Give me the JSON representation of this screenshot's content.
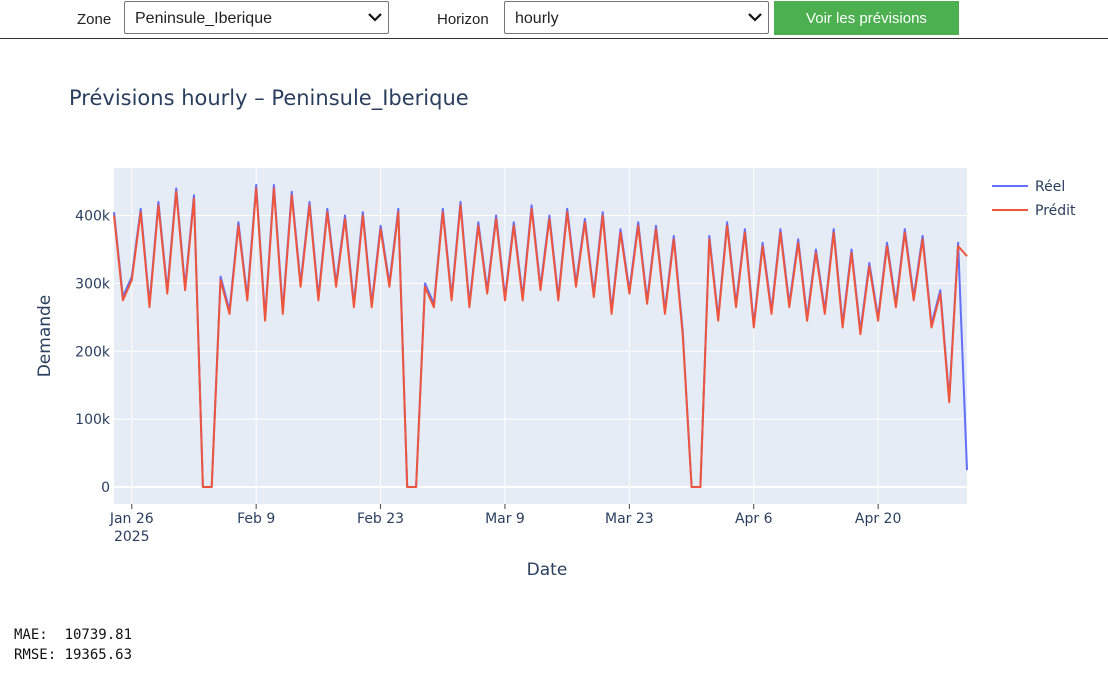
{
  "controls": {
    "zone_label": "Zone",
    "zone_value": "Peninsule_Iberique",
    "horizon_label": "Horizon",
    "horizon_value": "hourly",
    "submit_label": "Voir les prévisions"
  },
  "chart_data": {
    "type": "line",
    "title": "Prévisions hourly – Peninsule_Iberique",
    "xlabel": "Date",
    "ylabel": "Demande",
    "x_range": [
      "2025-01-24",
      "2025-04-30"
    ],
    "ylim": [
      -25000,
      470000
    ],
    "x_ticks": [
      {
        "date": "2025-01-26",
        "label": "Jan 26",
        "sublabel": "2025"
      },
      {
        "date": "2025-02-09",
        "label": "Feb 9"
      },
      {
        "date": "2025-02-23",
        "label": "Feb 23"
      },
      {
        "date": "2025-03-09",
        "label": "Mar 9"
      },
      {
        "date": "2025-03-23",
        "label": "Mar 23"
      },
      {
        "date": "2025-04-06",
        "label": "Apr 6"
      },
      {
        "date": "2025-04-20",
        "label": "Apr 20"
      }
    ],
    "y_ticks": [
      {
        "value": 0,
        "label": "0"
      },
      {
        "value": 100000,
        "label": "100k"
      },
      {
        "value": 200000,
        "label": "200k"
      },
      {
        "value": 300000,
        "label": "300k"
      },
      {
        "value": 400000,
        "label": "400k"
      }
    ],
    "grid": true,
    "legend_position": "top-right",
    "plot_bgcolor": "#e5ecf6",
    "series": [
      {
        "name": "Réel",
        "color": "#636efa",
        "points": [
          [
            "2025-01-24",
            405000
          ],
          [
            "2025-01-25",
            280000
          ],
          [
            "2025-01-26",
            310000
          ],
          [
            "2025-01-27",
            410000
          ],
          [
            "2025-01-28",
            270000
          ],
          [
            "2025-01-29",
            420000
          ],
          [
            "2025-01-30",
            290000
          ],
          [
            "2025-01-31",
            440000
          ],
          [
            "2025-02-01",
            295000
          ],
          [
            "2025-02-02",
            430000
          ],
          [
            "2025-02-03",
            0
          ],
          [
            "2025-02-04",
            0
          ],
          [
            "2025-02-05",
            310000
          ],
          [
            "2025-02-06",
            260000
          ],
          [
            "2025-02-07",
            390000
          ],
          [
            "2025-02-08",
            280000
          ],
          [
            "2025-02-09",
            445000
          ],
          [
            "2025-02-10",
            250000
          ],
          [
            "2025-02-11",
            445000
          ],
          [
            "2025-02-12",
            260000
          ],
          [
            "2025-02-13",
            435000
          ],
          [
            "2025-02-14",
            300000
          ],
          [
            "2025-02-15",
            420000
          ],
          [
            "2025-02-16",
            280000
          ],
          [
            "2025-02-17",
            410000
          ],
          [
            "2025-02-18",
            300000
          ],
          [
            "2025-02-19",
            400000
          ],
          [
            "2025-02-20",
            270000
          ],
          [
            "2025-02-21",
            405000
          ],
          [
            "2025-02-22",
            270000
          ],
          [
            "2025-02-23",
            385000
          ],
          [
            "2025-02-24",
            300000
          ],
          [
            "2025-02-25",
            410000
          ],
          [
            "2025-02-26",
            0
          ],
          [
            "2025-02-27",
            0
          ],
          [
            "2025-02-28",
            300000
          ],
          [
            "2025-03-01",
            270000
          ],
          [
            "2025-03-02",
            410000
          ],
          [
            "2025-03-03",
            280000
          ],
          [
            "2025-03-04",
            420000
          ],
          [
            "2025-03-05",
            270000
          ],
          [
            "2025-03-06",
            390000
          ],
          [
            "2025-03-07",
            290000
          ],
          [
            "2025-03-08",
            400000
          ],
          [
            "2025-03-09",
            280000
          ],
          [
            "2025-03-10",
            390000
          ],
          [
            "2025-03-11",
            280000
          ],
          [
            "2025-03-12",
            415000
          ],
          [
            "2025-03-13",
            295000
          ],
          [
            "2025-03-14",
            400000
          ],
          [
            "2025-03-15",
            280000
          ],
          [
            "2025-03-16",
            410000
          ],
          [
            "2025-03-17",
            300000
          ],
          [
            "2025-03-18",
            395000
          ],
          [
            "2025-03-19",
            285000
          ],
          [
            "2025-03-20",
            405000
          ],
          [
            "2025-03-21",
            260000
          ],
          [
            "2025-03-22",
            380000
          ],
          [
            "2025-03-23",
            290000
          ],
          [
            "2025-03-24",
            390000
          ],
          [
            "2025-03-25",
            275000
          ],
          [
            "2025-03-26",
            385000
          ],
          [
            "2025-03-27",
            260000
          ],
          [
            "2025-03-28",
            370000
          ],
          [
            "2025-03-29",
            230000
          ],
          [
            "2025-03-30",
            0
          ],
          [
            "2025-03-31",
            0
          ],
          [
            "2025-04-01",
            370000
          ],
          [
            "2025-04-02",
            250000
          ],
          [
            "2025-04-03",
            390000
          ],
          [
            "2025-04-04",
            270000
          ],
          [
            "2025-04-05",
            380000
          ],
          [
            "2025-04-06",
            240000
          ],
          [
            "2025-04-07",
            360000
          ],
          [
            "2025-04-08",
            260000
          ],
          [
            "2025-04-09",
            380000
          ],
          [
            "2025-04-10",
            270000
          ],
          [
            "2025-04-11",
            365000
          ],
          [
            "2025-04-12",
            250000
          ],
          [
            "2025-04-13",
            350000
          ],
          [
            "2025-04-14",
            260000
          ],
          [
            "2025-04-15",
            380000
          ],
          [
            "2025-04-16",
            240000
          ],
          [
            "2025-04-17",
            350000
          ],
          [
            "2025-04-18",
            230000
          ],
          [
            "2025-04-19",
            330000
          ],
          [
            "2025-04-20",
            250000
          ],
          [
            "2025-04-21",
            360000
          ],
          [
            "2025-04-22",
            270000
          ],
          [
            "2025-04-23",
            380000
          ],
          [
            "2025-04-24",
            280000
          ],
          [
            "2025-04-25",
            370000
          ],
          [
            "2025-04-26",
            240000
          ],
          [
            "2025-04-27",
            290000
          ],
          [
            "2025-04-28",
            130000
          ],
          [
            "2025-04-29",
            360000
          ],
          [
            "2025-04-30",
            25000
          ]
        ]
      },
      {
        "name": "Prédit",
        "color": "#ef553b",
        "points": [
          [
            "2025-01-24",
            400000
          ],
          [
            "2025-01-25",
            275000
          ],
          [
            "2025-01-26",
            305000
          ],
          [
            "2025-01-27",
            405000
          ],
          [
            "2025-01-28",
            265000
          ],
          [
            "2025-01-29",
            415000
          ],
          [
            "2025-01-30",
            285000
          ],
          [
            "2025-01-31",
            435000
          ],
          [
            "2025-02-01",
            290000
          ],
          [
            "2025-02-02",
            425000
          ],
          [
            "2025-02-03",
            0
          ],
          [
            "2025-02-04",
            0
          ],
          [
            "2025-02-05",
            305000
          ],
          [
            "2025-02-06",
            255000
          ],
          [
            "2025-02-07",
            385000
          ],
          [
            "2025-02-08",
            275000
          ],
          [
            "2025-02-09",
            440000
          ],
          [
            "2025-02-10",
            245000
          ],
          [
            "2025-02-11",
            440000
          ],
          [
            "2025-02-12",
            255000
          ],
          [
            "2025-02-13",
            430000
          ],
          [
            "2025-02-14",
            295000
          ],
          [
            "2025-02-15",
            415000
          ],
          [
            "2025-02-16",
            275000
          ],
          [
            "2025-02-17",
            405000
          ],
          [
            "2025-02-18",
            295000
          ],
          [
            "2025-02-19",
            395000
          ],
          [
            "2025-02-20",
            265000
          ],
          [
            "2025-02-21",
            400000
          ],
          [
            "2025-02-22",
            265000
          ],
          [
            "2025-02-23",
            380000
          ],
          [
            "2025-02-24",
            295000
          ],
          [
            "2025-02-25",
            405000
          ],
          [
            "2025-02-26",
            0
          ],
          [
            "2025-02-27",
            0
          ],
          [
            "2025-02-28",
            295000
          ],
          [
            "2025-03-01",
            265000
          ],
          [
            "2025-03-02",
            405000
          ],
          [
            "2025-03-03",
            275000
          ],
          [
            "2025-03-04",
            415000
          ],
          [
            "2025-03-05",
            265000
          ],
          [
            "2025-03-06",
            385000
          ],
          [
            "2025-03-07",
            285000
          ],
          [
            "2025-03-08",
            395000
          ],
          [
            "2025-03-09",
            275000
          ],
          [
            "2025-03-10",
            385000
          ],
          [
            "2025-03-11",
            275000
          ],
          [
            "2025-03-12",
            410000
          ],
          [
            "2025-03-13",
            290000
          ],
          [
            "2025-03-14",
            395000
          ],
          [
            "2025-03-15",
            275000
          ],
          [
            "2025-03-16",
            405000
          ],
          [
            "2025-03-17",
            295000
          ],
          [
            "2025-03-18",
            390000
          ],
          [
            "2025-03-19",
            280000
          ],
          [
            "2025-03-20",
            400000
          ],
          [
            "2025-03-21",
            255000
          ],
          [
            "2025-03-22",
            375000
          ],
          [
            "2025-03-23",
            285000
          ],
          [
            "2025-03-24",
            385000
          ],
          [
            "2025-03-25",
            270000
          ],
          [
            "2025-03-26",
            380000
          ],
          [
            "2025-03-27",
            255000
          ],
          [
            "2025-03-28",
            365000
          ],
          [
            "2025-03-29",
            225000
          ],
          [
            "2025-03-30",
            0
          ],
          [
            "2025-03-31",
            0
          ],
          [
            "2025-04-01",
            365000
          ],
          [
            "2025-04-02",
            245000
          ],
          [
            "2025-04-03",
            385000
          ],
          [
            "2025-04-04",
            265000
          ],
          [
            "2025-04-05",
            375000
          ],
          [
            "2025-04-06",
            235000
          ],
          [
            "2025-04-07",
            355000
          ],
          [
            "2025-04-08",
            255000
          ],
          [
            "2025-04-09",
            375000
          ],
          [
            "2025-04-10",
            265000
          ],
          [
            "2025-04-11",
            360000
          ],
          [
            "2025-04-12",
            245000
          ],
          [
            "2025-04-13",
            345000
          ],
          [
            "2025-04-14",
            255000
          ],
          [
            "2025-04-15",
            375000
          ],
          [
            "2025-04-16",
            235000
          ],
          [
            "2025-04-17",
            345000
          ],
          [
            "2025-04-18",
            225000
          ],
          [
            "2025-04-19",
            325000
          ],
          [
            "2025-04-20",
            245000
          ],
          [
            "2025-04-21",
            355000
          ],
          [
            "2025-04-22",
            265000
          ],
          [
            "2025-04-23",
            375000
          ],
          [
            "2025-04-24",
            275000
          ],
          [
            "2025-04-25",
            365000
          ],
          [
            "2025-04-26",
            235000
          ],
          [
            "2025-04-27",
            285000
          ],
          [
            "2025-04-28",
            125000
          ],
          [
            "2025-04-29",
            355000
          ],
          [
            "2025-04-30",
            340000
          ]
        ]
      }
    ]
  },
  "metrics": {
    "mae_label": "MAE:  ",
    "mae_value": "10739.81",
    "rmse_label": "RMSE: ",
    "rmse_value": "19365.63"
  }
}
